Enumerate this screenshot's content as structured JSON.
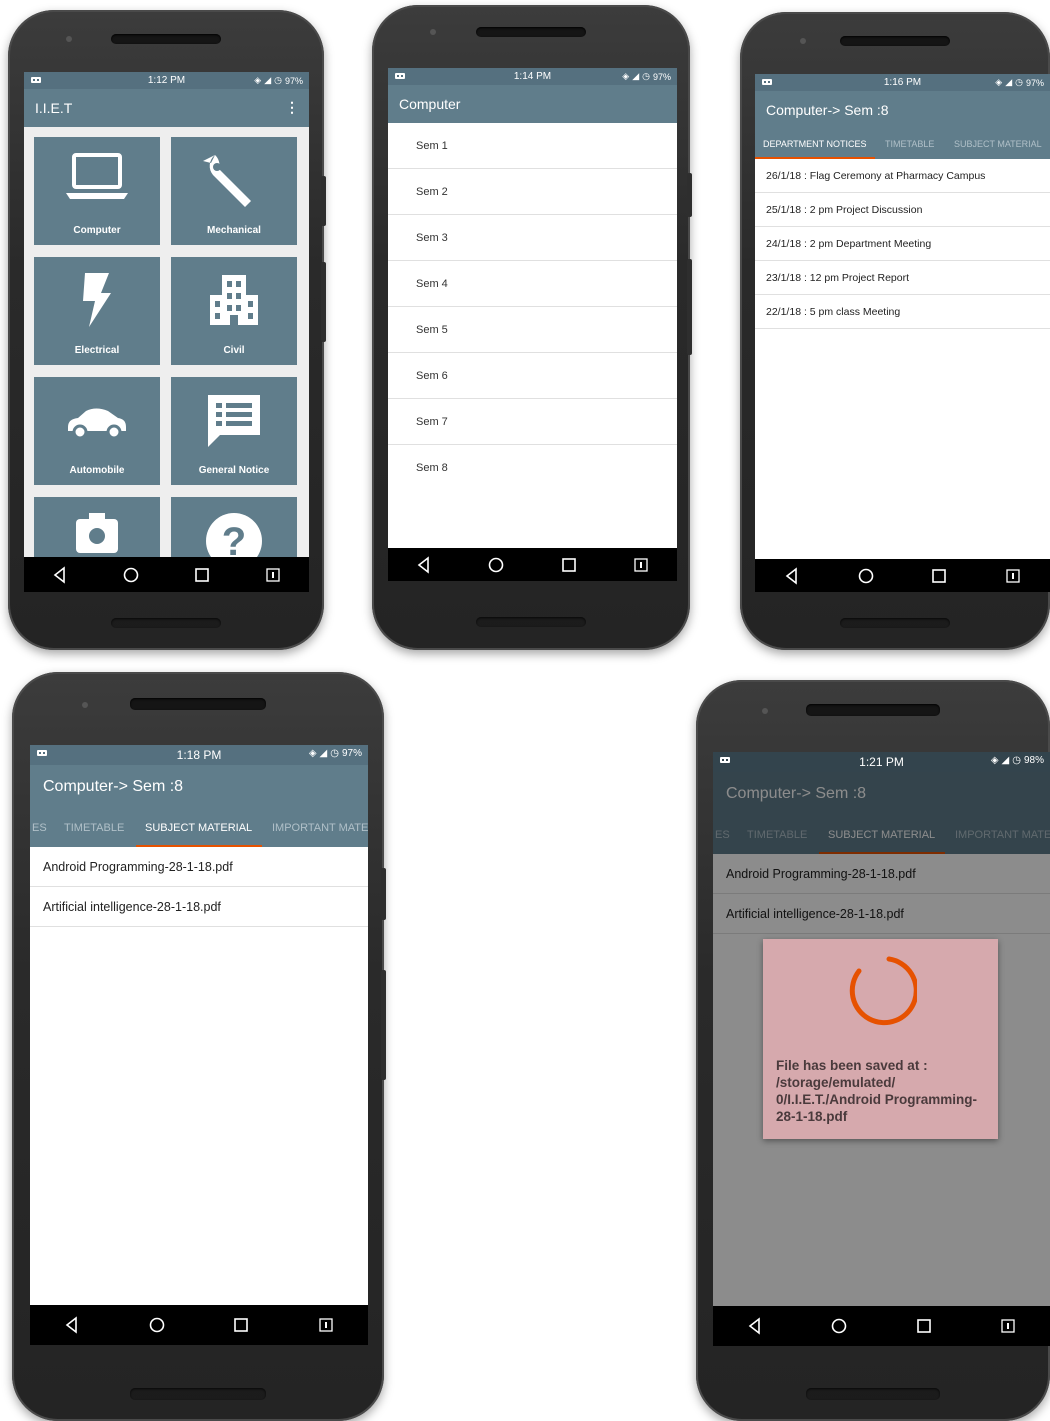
{
  "colors": {
    "primary": "#607d8b",
    "primary_dark": "#55707f",
    "accent": "#e65100",
    "dialog_bg": "#d6a9ad"
  },
  "phone1": {
    "status": {
      "time": "1:12 PM",
      "battery": "97%"
    },
    "app_title": "I.I.E.T",
    "tiles": [
      {
        "label": "Computer",
        "icon": "laptop-icon"
      },
      {
        "label": "Mechanical",
        "icon": "wrench-icon"
      },
      {
        "label": "Electrical",
        "icon": "lightning-icon"
      },
      {
        "label": "Civil",
        "icon": "building-icon"
      },
      {
        "label": "Automobile",
        "icon": "car-icon"
      },
      {
        "label": "General Notice",
        "icon": "notice-icon"
      },
      {
        "label": "",
        "icon": "camera-badge-icon"
      },
      {
        "label": "",
        "icon": "help-icon"
      }
    ]
  },
  "phone2": {
    "status": {
      "time": "1:14 PM",
      "battery": "97%"
    },
    "app_title": "Computer",
    "semesters": [
      "Sem 1",
      "Sem 2",
      "Sem 3",
      "Sem 4",
      "Sem 5",
      "Sem 6",
      "Sem 7",
      "Sem 8"
    ]
  },
  "phone3": {
    "status": {
      "time": "1:16 PM",
      "battery": "97%"
    },
    "app_title": "Computer-> Sem :8",
    "tabs": [
      "DEPARTMENT NOTICES",
      "TIMETABLE",
      "SUBJECT MATERIAL"
    ],
    "active_tab": "DEPARTMENT NOTICES",
    "notices": [
      "26/1/18 : Flag Ceremony at Pharmacy Campus",
      "25/1/18 : 2 pm Project Discussion",
      "24/1/18 : 2 pm Department Meeting",
      "23/1/18 : 12 pm Project Report",
      "22/1/18 : 5 pm class Meeting"
    ]
  },
  "phone4": {
    "status": {
      "time": "1:18 PM",
      "battery": "97%"
    },
    "app_title": "Computer-> Sem :8",
    "tabs": [
      "ES",
      "TIMETABLE",
      "SUBJECT MATERIAL",
      "IMPORTANT MATE"
    ],
    "active_tab": "SUBJECT MATERIAL",
    "files": [
      "Android Programming-28-1-18.pdf",
      "Artificial intelligence-28-1-18.pdf"
    ]
  },
  "phone5": {
    "status": {
      "time": "1:21 PM",
      "battery": "98%"
    },
    "app_title": "Computer-> Sem :8",
    "tabs": [
      "ES",
      "TIMETABLE",
      "SUBJECT MATERIAL",
      "IMPORTANT MATE"
    ],
    "active_tab": "SUBJECT MATERIAL",
    "files": [
      "Android Programming-28-1-18.pdf",
      "Artificial intelligence-28-1-18.pdf"
    ],
    "dialog_message": "File has been saved at : /storage/emulated/ 0/I.I.E.T./Android Programming-28-1-18.pdf"
  }
}
